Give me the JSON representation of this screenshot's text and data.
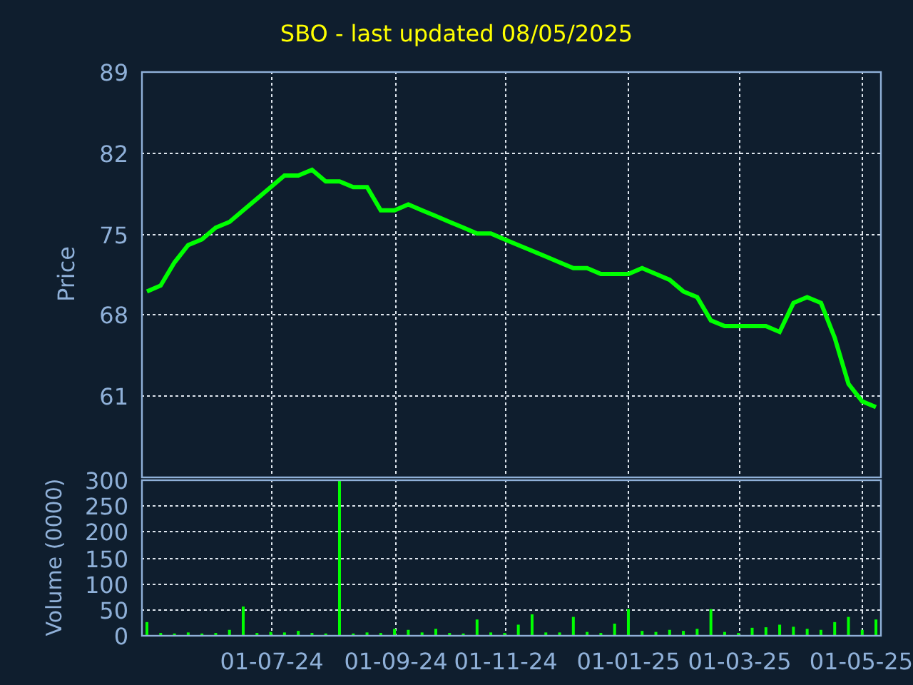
{
  "title": "SBO - last updated 08/05/2025",
  "price_chart": {
    "chart_data": {
      "type": "line",
      "ylabel": "Price",
      "series": [
        {
          "color": "#00ff00",
          "values": [
            70,
            70.5,
            72.5,
            74,
            74.5,
            75.5,
            76,
            77,
            78,
            79,
            80,
            80,
            80.5,
            79.5,
            79.5,
            79,
            79,
            77,
            77,
            77.5,
            77,
            76.5,
            76,
            75.5,
            75,
            75,
            74.5,
            74,
            73.5,
            73,
            72.5,
            72,
            72,
            71.5,
            71.5,
            71.5,
            72,
            71.5,
            71,
            70,
            69.5,
            67.5,
            67,
            67,
            67,
            67,
            66.5,
            69,
            69.5,
            69,
            66,
            62,
            60.5,
            60
          ]
        }
      ],
      "ylim": [
        54,
        89
      ],
      "grid": true,
      "yticks": [
        {
          "value": 61,
          "label": "61"
        },
        {
          "value": 68,
          "label": "68"
        },
        {
          "value": 75,
          "label": "75"
        },
        {
          "value": 82,
          "label": "82"
        },
        {
          "value": 89,
          "label": "89"
        }
      ]
    }
  },
  "volume_chart": {
    "chart_data": {
      "type": "bar",
      "ylabel": "Volume (0000)",
      "categories": [
        null,
        null,
        null,
        null,
        null,
        null,
        null,
        null,
        null,
        "01-07-24",
        null,
        null,
        null,
        null,
        null,
        null,
        null,
        null,
        "01-09-24",
        null,
        null,
        null,
        null,
        null,
        null,
        null,
        "01-11-24",
        null,
        null,
        null,
        null,
        null,
        null,
        null,
        null,
        "01-01-25",
        null,
        null,
        null,
        null,
        null,
        null,
        null,
        "01-03-25",
        null,
        null,
        null,
        null,
        null,
        null,
        null,
        null,
        "01-05-25",
        null
      ],
      "series": [
        {
          "color": "#00ff00",
          "values": [
            25,
            4,
            3,
            5,
            3,
            4,
            10,
            55,
            4,
            6,
            5,
            8,
            4,
            3,
            300,
            3,
            5,
            4,
            12,
            10,
            5,
            12,
            4,
            3,
            30,
            5,
            4,
            20,
            40,
            5,
            5,
            35,
            6,
            4,
            22,
            50,
            8,
            6,
            10,
            8,
            12,
            50,
            6,
            4,
            14,
            15,
            20,
            16,
            12,
            10,
            25,
            35,
            10,
            30
          ]
        }
      ],
      "ylim": [
        0,
        300
      ],
      "grid": true,
      "yticks": [
        {
          "value": 0,
          "label": "0"
        },
        {
          "value": 50,
          "label": "50"
        },
        {
          "value": 100,
          "label": "100"
        },
        {
          "value": 150,
          "label": "150"
        },
        {
          "value": 200,
          "label": "200"
        },
        {
          "value": 250,
          "label": "250"
        },
        {
          "value": 300,
          "label": "300"
        }
      ]
    }
  }
}
